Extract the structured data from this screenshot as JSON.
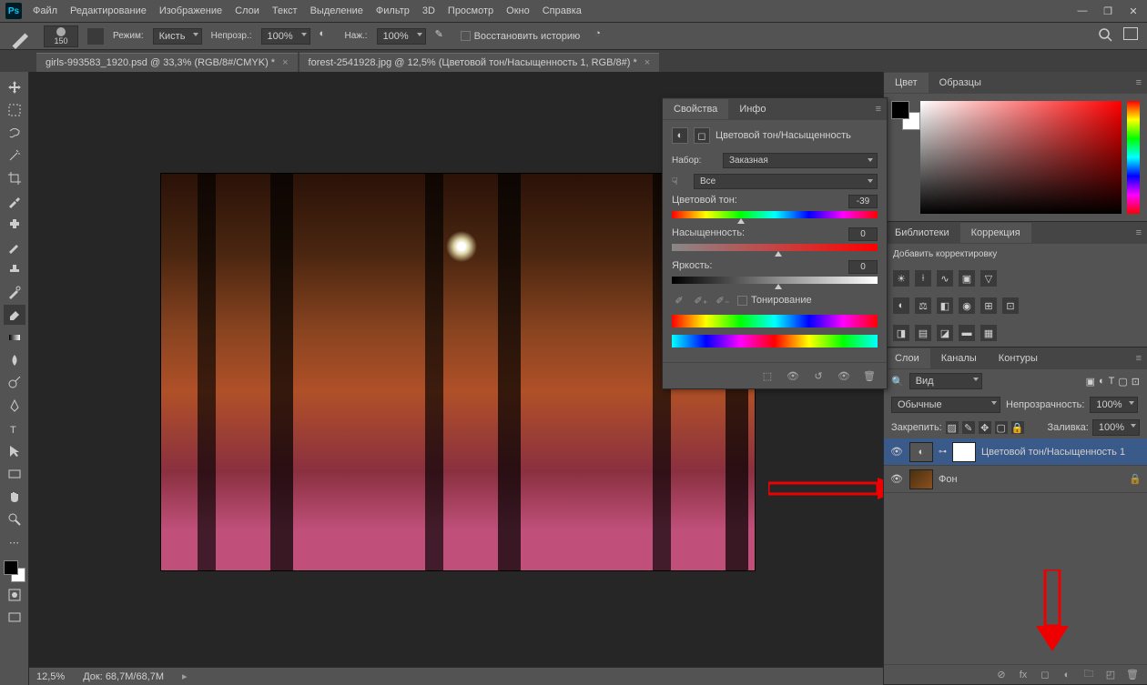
{
  "menu": {
    "items": [
      "Файл",
      "Редактирование",
      "Изображение",
      "Слои",
      "Текст",
      "Выделение",
      "Фильтр",
      "3D",
      "Просмотр",
      "Окно",
      "Справка"
    ]
  },
  "optbar": {
    "brush_size": "150",
    "mode_lbl": "Режим:",
    "mode_val": "Кисть",
    "opacity_lbl": "Непрозр.:",
    "opacity_val": "100%",
    "flow_lbl": "Наж.:",
    "flow_val": "100%",
    "history_lbl": "Восстановить историю"
  },
  "tabs": [
    {
      "title": "girls-993583_1920.psd @ 33,3% (RGB/8#/CMYK) *"
    },
    {
      "title": "forest-2541928.jpg @ 12,5% (Цветовой тон/Насыщенность 1, RGB/8#) *"
    }
  ],
  "status": {
    "zoom": "12,5%",
    "doc": "Док: 68,7M/68,7M"
  },
  "props": {
    "tab1": "Свойства",
    "tab2": "Инфо",
    "title": "Цветовой тон/Насыщенность",
    "preset_lbl": "Набор:",
    "preset_val": "Заказная",
    "channel_val": "Все",
    "hue_lbl": "Цветовой тон:",
    "hue_val": "-39",
    "sat_lbl": "Насыщенность:",
    "sat_val": "0",
    "light_lbl": "Яркость:",
    "light_val": "0",
    "toning_lbl": "Тонирование"
  },
  "right": {
    "color_tab": "Цвет",
    "swatches_tab": "Образцы",
    "lib_tab": "Библиотеки",
    "adj_tab": "Коррекция",
    "adj_title": "Добавить корректировку",
    "layers_tab": "Слои",
    "channels_tab": "Каналы",
    "paths_tab": "Контуры",
    "kind_lbl": "Вид",
    "blend_val": "Обычные",
    "opacity_lbl": "Непрозрачность:",
    "opacity_val": "100%",
    "lock_lbl": "Закрепить:",
    "fill_lbl": "Заливка:",
    "fill_val": "100%",
    "layer1": "Цветовой тон/Насыщенность 1",
    "layer2": "Фон"
  }
}
